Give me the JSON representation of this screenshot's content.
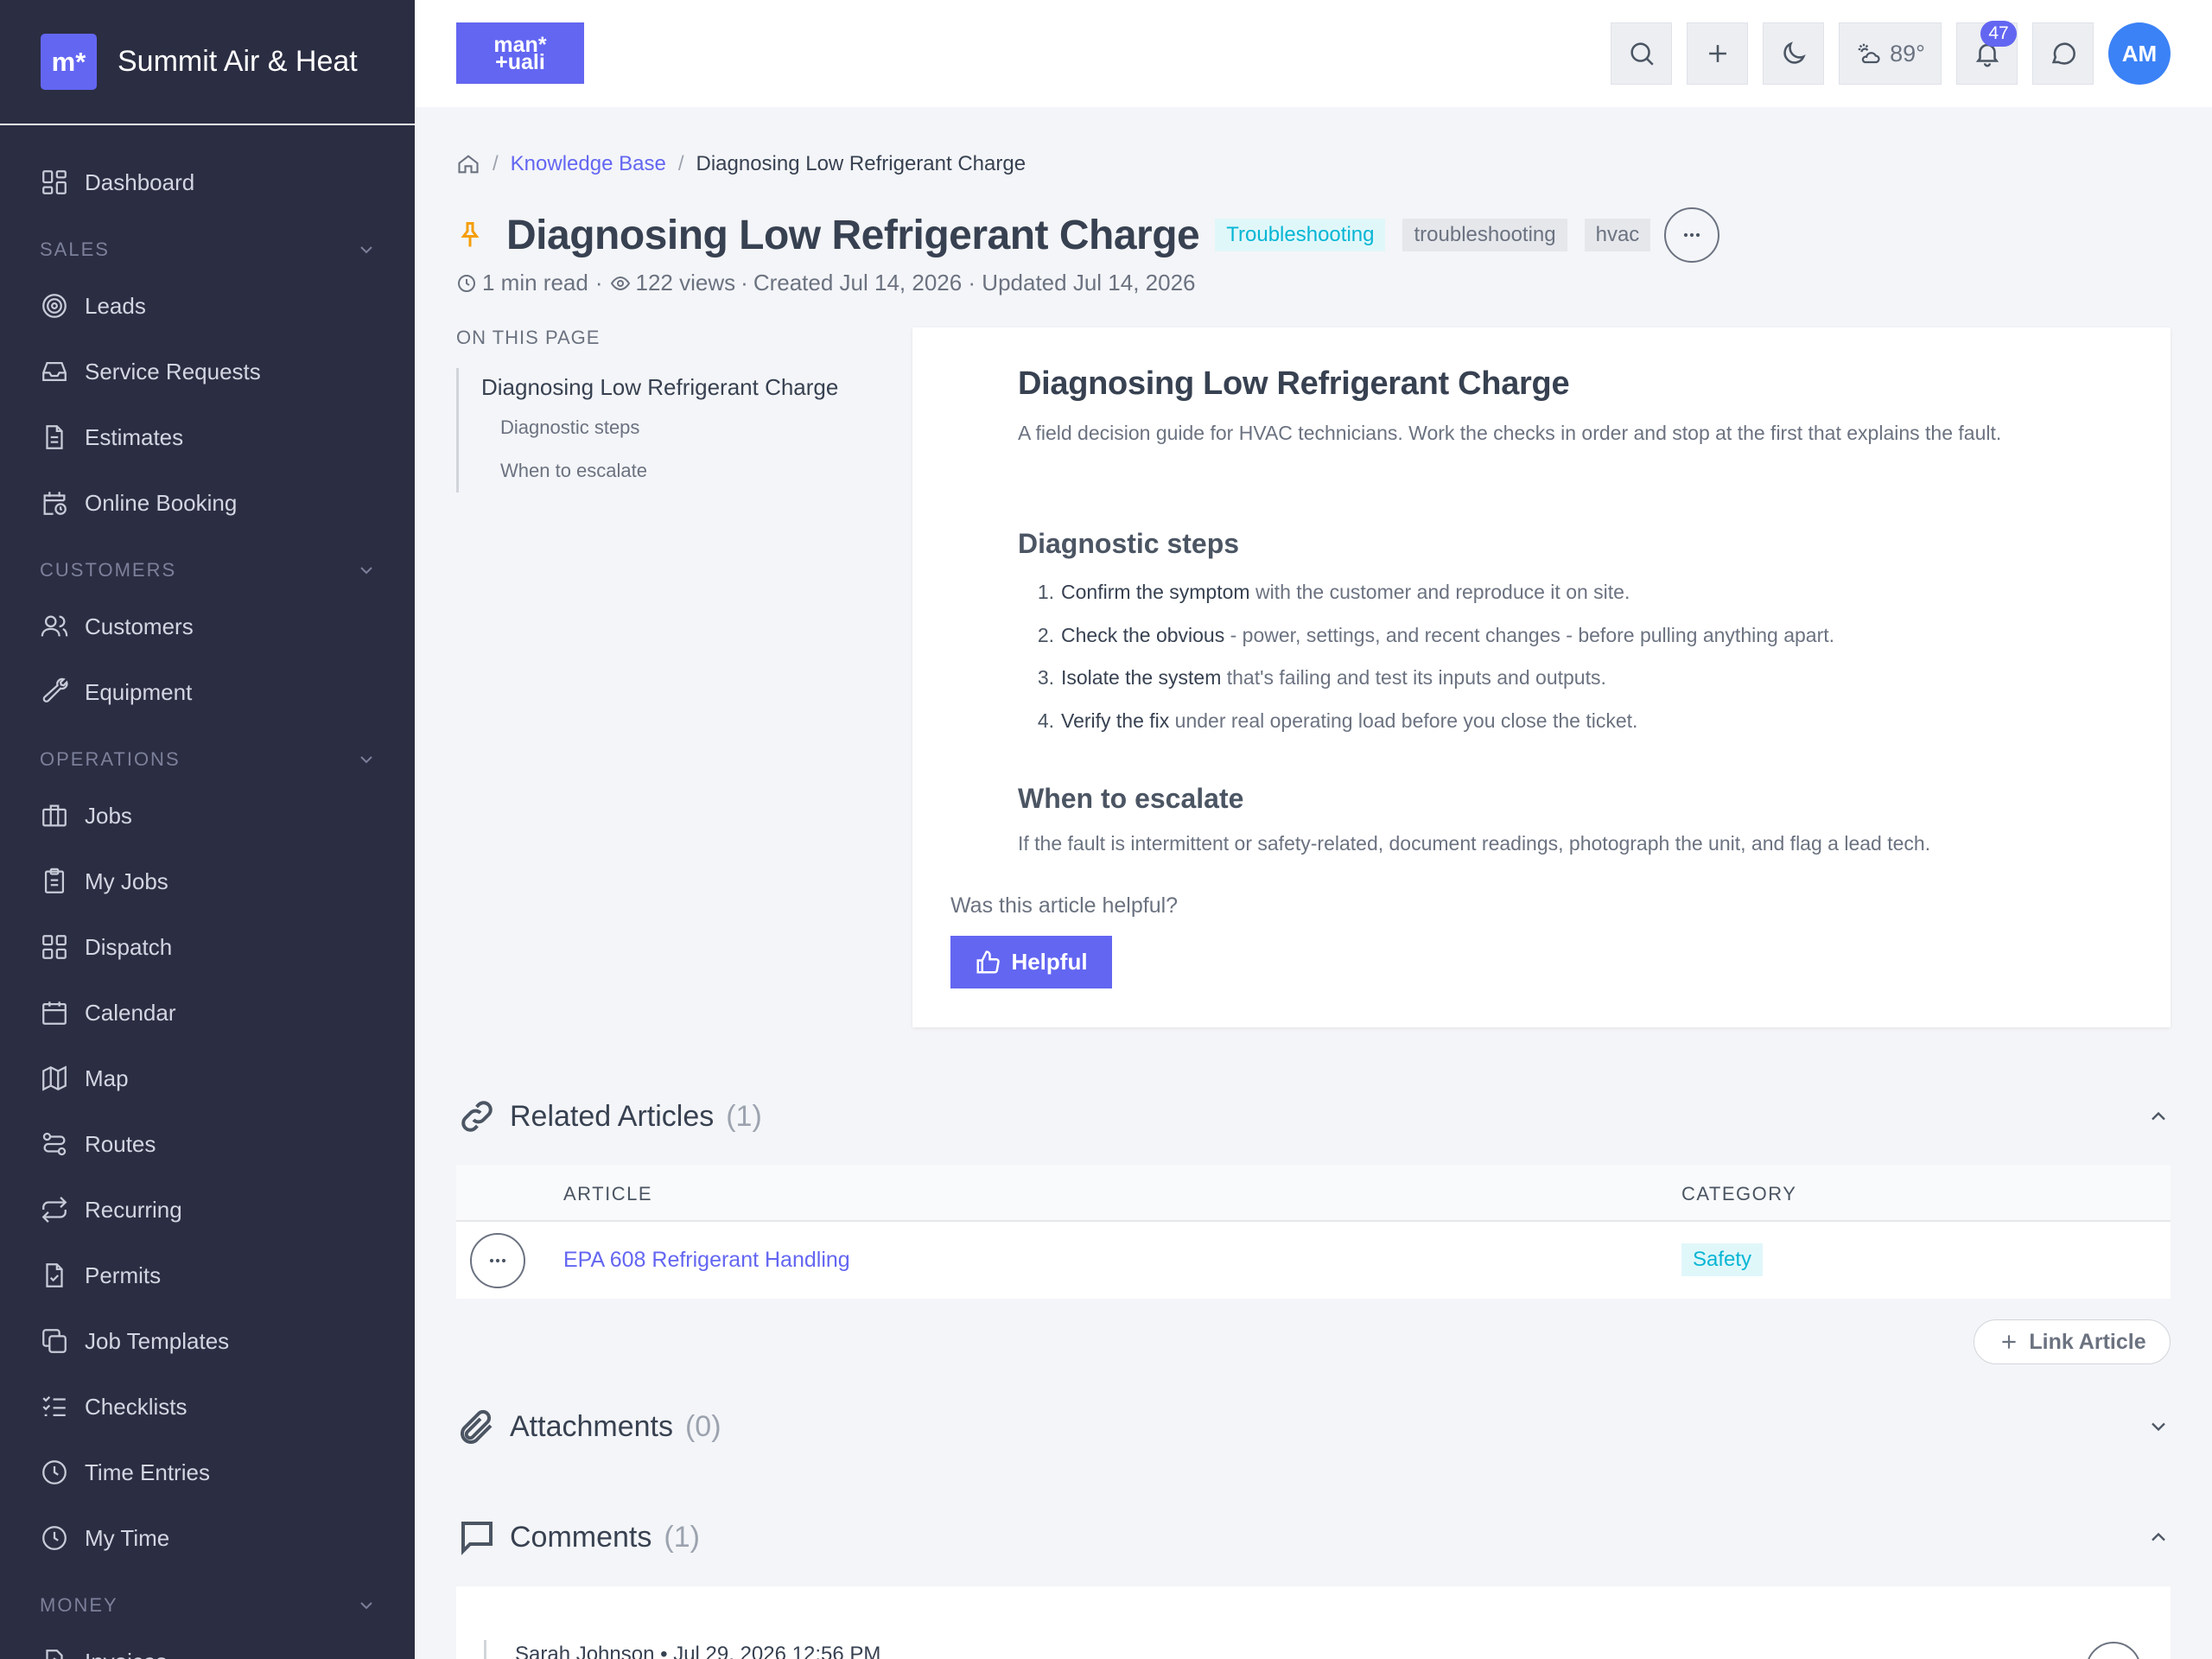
{
  "sidebar": {
    "brand_logo": "m*",
    "brand_name": "Summit Air & Heat",
    "dashboard": {
      "label": "Dashboard",
      "icon": "dashboard-grid-icon"
    },
    "sales": {
      "title": "SALES",
      "items": [
        {
          "label": "Leads",
          "icon": "target-icon"
        },
        {
          "label": "Service Requests",
          "icon": "inbox-icon"
        },
        {
          "label": "Estimates",
          "icon": "document-icon"
        },
        {
          "label": "Online Booking",
          "icon": "calendar-clock-icon"
        }
      ]
    },
    "customers": {
      "title": "CUSTOMERS",
      "items": [
        {
          "label": "Customers",
          "icon": "users-icon"
        },
        {
          "label": "Equipment",
          "icon": "wrench-icon"
        }
      ]
    },
    "operations": {
      "title": "OPERATIONS",
      "items": [
        {
          "label": "Jobs",
          "icon": "briefcase-icon"
        },
        {
          "label": "My Jobs",
          "icon": "clipboard-icon"
        },
        {
          "label": "Dispatch",
          "icon": "grid-icon"
        },
        {
          "label": "Calendar",
          "icon": "calendar-icon"
        },
        {
          "label": "Map",
          "icon": "map-icon"
        },
        {
          "label": "Routes",
          "icon": "route-icon"
        },
        {
          "label": "Recurring",
          "icon": "repeat-icon"
        },
        {
          "label": "Permits",
          "icon": "file-check-icon"
        },
        {
          "label": "Job Templates",
          "icon": "copy-icon"
        },
        {
          "label": "Checklists",
          "icon": "checklist-icon"
        },
        {
          "label": "Time Entries",
          "icon": "clock-icon"
        },
        {
          "label": "My Time",
          "icon": "clock-icon"
        }
      ]
    },
    "money": {
      "title": "MONEY",
      "items": [
        {
          "label": "Invoices",
          "icon": "invoice-icon"
        }
      ]
    }
  },
  "topbar": {
    "logo_line1": "man*",
    "logo_line2": "+uali",
    "weather": "89°",
    "notifications_count": "47",
    "avatar_initials": "AM"
  },
  "breadcrumb": {
    "link": "Knowledge Base",
    "current": "Diagnosing Low Refrigerant Charge"
  },
  "article_header": {
    "title": "Diagnosing Low Refrigerant Charge",
    "category": "Troubleshooting",
    "tags": [
      "troubleshooting",
      "hvac"
    ],
    "read_time": "1 min read",
    "views": "122 views",
    "dates": "Created Jul 14, 2026 · Updated Jul 14, 2026"
  },
  "toc": {
    "heading": "ON THIS PAGE",
    "main": "Diagnosing Low Refrigerant Charge",
    "items": [
      "Diagnostic steps",
      "When to escalate"
    ]
  },
  "article": {
    "h1": "Diagnosing Low Refrigerant Charge",
    "intro": "A field decision guide for HVAC technicians. Work the checks in order and stop at the first that explains the fault.",
    "steps_heading": "Diagnostic steps",
    "steps": [
      {
        "num": "1.",
        "bold": "Confirm the symptom",
        "text": " with the customer and reproduce it on site."
      },
      {
        "num": "2.",
        "bold": "Check the obvious",
        "text": " - power, settings, and recent changes - before pulling anything apart."
      },
      {
        "num": "3.",
        "bold": "Isolate the system",
        "text": " that's failing and test its inputs and outputs."
      },
      {
        "num": "4.",
        "bold": "Verify the fix",
        "text": " under real operating load before you close the ticket."
      }
    ],
    "escalate_heading": "When to escalate",
    "escalate_text": "If the fault is intermittent or safety-related, document readings, photograph the unit, and flag a lead tech.",
    "helpful_question": "Was this article helpful?",
    "helpful_button": "Helpful"
  },
  "related": {
    "title": "Related Articles",
    "count": "(1)",
    "col_article": "ARTICLE",
    "col_category": "CATEGORY",
    "rows": [
      {
        "article": "EPA 608 Refrigerant Handling",
        "category": "Safety"
      }
    ],
    "link_button": "Link Article"
  },
  "attachments": {
    "title": "Attachments",
    "count": "(0)"
  },
  "comments": {
    "title": "Comments",
    "count": "(1)",
    "first_author": "Sarah Johnson • Jul 29, 2026 12:56 PM"
  }
}
